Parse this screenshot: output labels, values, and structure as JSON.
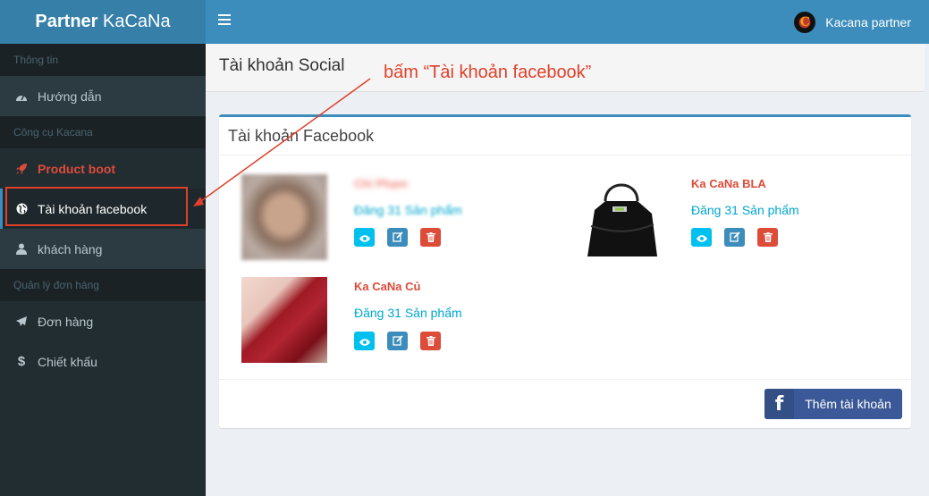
{
  "header": {
    "brand_bold": "Partner",
    "brand_rest": " KaCaNa",
    "user_name": "Kacana partner",
    "avatar_letter": "C"
  },
  "sidebar": {
    "sections": [
      {
        "label": "Thông tin"
      },
      {
        "label": "Công cụ Kacana"
      },
      {
        "label": "Quản lý đơn hàng"
      }
    ],
    "items": [
      {
        "label": "Hướng dẫn",
        "icon": "tachometer-icon"
      },
      {
        "label": "Product boot",
        "icon": "rocket-icon"
      },
      {
        "label": "Tài khoản facebook",
        "icon": "globe-icon"
      },
      {
        "label": "khách hàng",
        "icon": "user-icon"
      },
      {
        "label": "Đơn hàng",
        "icon": "plane-icon"
      },
      {
        "label": "Chiết khấu",
        "icon": "dollar-icon"
      }
    ]
  },
  "page": {
    "title": "Tài khoản Social",
    "annotation": "bấm “Tài khoản facebook”"
  },
  "box": {
    "title": "Tài khoản Facebook",
    "add_button": "Thêm tài khoản"
  },
  "accounts": [
    {
      "name": "Chi Phạm",
      "posts": "Đăng 31 Sản phẩm"
    },
    {
      "name": "Ka CaNa BLA",
      "posts": "Đăng 31 Sản phẩm"
    },
    {
      "name": "Ka CaNa Củ",
      "posts": "Đăng 31 Sản phẩm"
    }
  ],
  "colors": {
    "accent": "#3c8dbc",
    "danger": "#dd4b39",
    "info": "#00c0ef",
    "facebook": "#3b5998",
    "annotation": "#e0402a"
  }
}
